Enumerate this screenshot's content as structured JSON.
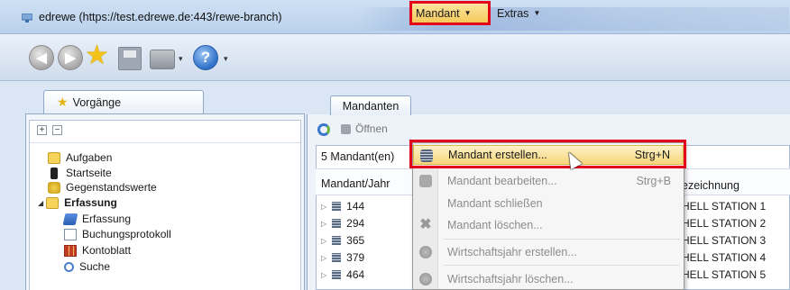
{
  "window": {
    "title": "edrewe (https://test.edrewe.de:443/rewe-branch)"
  },
  "left_panel": {
    "tab_label": "Vorgänge",
    "tree": [
      {
        "label": "Aufgaben",
        "icon": "folder-icon"
      },
      {
        "label": "Startseite",
        "icon": "traffic-light-icon"
      },
      {
        "label": "Gegenstandswerte",
        "icon": "gold-icon"
      },
      {
        "label": "Erfassung",
        "icon": "folder-icon",
        "bold": true,
        "expanded": true
      },
      {
        "label": "Erfassung",
        "icon": "book-icon"
      },
      {
        "label": "Buchungsprotokoll",
        "icon": "document-icon"
      },
      {
        "label": "Kontoblatt",
        "icon": "grid-icon"
      },
      {
        "label": "Suche",
        "icon": "search-icon"
      }
    ]
  },
  "right_panel": {
    "tab_label": "Mandanten",
    "toolbar": {
      "open_label": "Öffnen",
      "menu_mandant": "Mandant",
      "menu_extras": "Extras"
    },
    "count_label": "5 Mandant(en)",
    "columns": {
      "col1": "Mandant/Jahr",
      "col2": "ezeichnung"
    },
    "rows": [
      {
        "number": "144",
        "name": "HELL STATION 1"
      },
      {
        "number": "294",
        "name": "HELL STATION 2"
      },
      {
        "number": "365",
        "name": "HELL STATION 3"
      },
      {
        "number": "379",
        "name": "HELL STATION 4"
      },
      {
        "number": "464",
        "name": "HELL STATION 5"
      }
    ]
  },
  "mandant_menu": {
    "items": [
      {
        "label": "Mandant erstellen...",
        "shortcut": "Strg+N",
        "enabled": true,
        "highlighted": true
      },
      {
        "label": "Mandant bearbeiten...",
        "shortcut": "Strg+B",
        "enabled": false
      },
      {
        "label": "Mandant schließen",
        "shortcut": "",
        "enabled": false
      },
      {
        "label": "Mandant löschen...",
        "shortcut": "",
        "enabled": false
      },
      {
        "label": "Wirtschaftsjahr erstellen...",
        "shortcut": "",
        "enabled": false
      },
      {
        "label": "Wirtschaftsjahr löschen...",
        "shortcut": "",
        "enabled": false
      }
    ]
  },
  "colors": {
    "highlight_outline": "#e3001b",
    "menu_active": "#f7d77b",
    "window_chrome": "#dbe6f4"
  }
}
